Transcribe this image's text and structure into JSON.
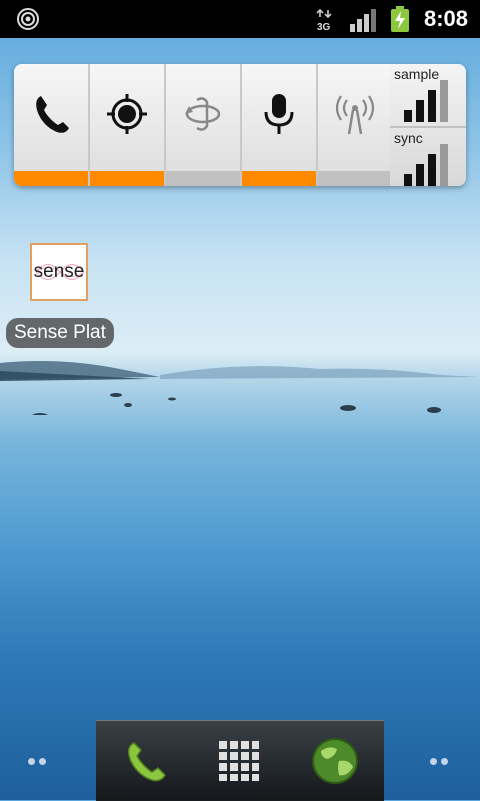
{
  "status_bar": {
    "time": "8:08",
    "network_type": "3G",
    "icons": [
      "notification-target-icon",
      "data-3g-icon",
      "signal-strength-icon",
      "battery-charging-icon"
    ]
  },
  "widget": {
    "toggles": [
      {
        "name": "phone-icon",
        "active": true
      },
      {
        "name": "gps-icon",
        "active": true
      },
      {
        "name": "sync-rotate-icon",
        "active": false
      },
      {
        "name": "microphone-icon",
        "active": true
      },
      {
        "name": "antenna-icon",
        "active": false
      }
    ],
    "meters": [
      {
        "label": "sample",
        "level": 0.75
      },
      {
        "label": "sync",
        "level": 0.75
      }
    ],
    "accent_color": "#ff8a00"
  },
  "shortcut": {
    "icon_text": "sense",
    "label": "Sense Plat"
  },
  "dock": {
    "icons": [
      "phone-icon",
      "app-drawer-icon",
      "browser-globe-icon"
    ]
  }
}
